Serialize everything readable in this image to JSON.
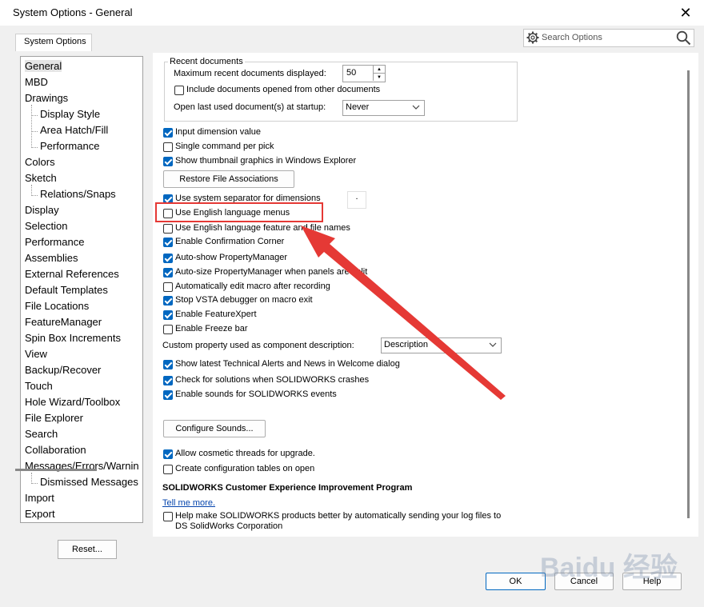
{
  "window": {
    "title": "System Options - General",
    "close_glyph": "✕"
  },
  "tab": {
    "label": "System Options"
  },
  "search": {
    "placeholder": "Search Options"
  },
  "tree": {
    "items": [
      {
        "label": "General",
        "selected": true
      },
      {
        "label": "MBD"
      },
      {
        "label": "Drawings"
      },
      {
        "label": "Display Style",
        "sub": true
      },
      {
        "label": "Area Hatch/Fill",
        "sub": true
      },
      {
        "label": "Performance",
        "sub": true
      },
      {
        "label": "Colors"
      },
      {
        "label": "Sketch"
      },
      {
        "label": "Relations/Snaps",
        "sub": true
      },
      {
        "label": "Display"
      },
      {
        "label": "Selection"
      },
      {
        "label": "Performance"
      },
      {
        "label": "Assemblies"
      },
      {
        "label": "External References"
      },
      {
        "label": "Default Templates"
      },
      {
        "label": "File Locations"
      },
      {
        "label": "FeatureManager"
      },
      {
        "label": "Spin Box Increments"
      },
      {
        "label": "View"
      },
      {
        "label": "Backup/Recover"
      },
      {
        "label": "Touch"
      },
      {
        "label": "Hole Wizard/Toolbox"
      },
      {
        "label": "File Explorer"
      },
      {
        "label": "Search"
      },
      {
        "label": "Collaboration"
      },
      {
        "label": "Messages/Errors/Warnin"
      },
      {
        "label": "Dismissed Messages",
        "sub": true
      },
      {
        "label": "Import"
      },
      {
        "label": "Export"
      }
    ]
  },
  "reset_button": "Reset...",
  "recent": {
    "legend": "Recent documents",
    "max_label": "Maximum recent documents displayed:",
    "max_value": "50",
    "include_label": "Include documents opened from other documents",
    "include_checked": false,
    "open_last_label": "Open last used document(s) at startup:",
    "open_last_value": "Never"
  },
  "options": {
    "input_dimension": {
      "label": "Input dimension value",
      "checked": true
    },
    "single_command": {
      "label": "Single command per pick",
      "checked": false
    },
    "show_thumbnail": {
      "label": "Show thumbnail graphics in Windows Explorer",
      "checked": true
    },
    "restore_assoc": "Restore File Associations",
    "system_separator": {
      "label": "Use system separator for dimensions",
      "checked": true,
      "value": "."
    },
    "english_menus": {
      "label": "Use English language menus",
      "checked": false
    },
    "english_feature": {
      "label": "Use English language feature and file names",
      "checked": false
    },
    "confirmation_corner": {
      "label": "Enable Confirmation Corner",
      "checked": true
    },
    "autoshow_pm": {
      "label": "Auto-show PropertyManager",
      "checked": true
    },
    "autosize_pm": {
      "label": "Auto-size PropertyManager when panels are split",
      "checked": true
    },
    "auto_edit_macro": {
      "label": "Automatically edit macro after recording",
      "checked": false
    },
    "stop_vsta": {
      "label": "Stop VSTA debugger on macro exit",
      "checked": true
    },
    "featurexpert": {
      "label": "Enable FeatureXpert",
      "checked": true
    },
    "freeze_bar": {
      "label": "Enable Freeze bar",
      "checked": false
    },
    "custom_prop_label": "Custom property used as component description:",
    "custom_prop_value": "Description",
    "show_alerts": {
      "label": "Show latest Technical Alerts and News in Welcome dialog",
      "checked": true
    },
    "check_solutions": {
      "label": "Check for solutions when SOLIDWORKS crashes",
      "checked": true
    },
    "enable_sounds": {
      "label": "Enable sounds for SOLIDWORKS events",
      "checked": true
    },
    "configure_sounds": "Configure Sounds...",
    "cosmetic_threads": {
      "label": "Allow cosmetic threads for upgrade.",
      "checked": true
    },
    "config_tables": {
      "label": "Create configuration tables on open",
      "checked": false
    }
  },
  "ceip": {
    "title": "SOLIDWORKS Customer Experience Improvement Program",
    "link": "Tell me more.",
    "help_line1": "Help make SOLIDWORKS products better by automatically sending your log files to",
    "help_line2": "DS SolidWorks Corporation",
    "help_checked": false
  },
  "footer": {
    "ok": "OK",
    "cancel": "Cancel",
    "help": "Help"
  },
  "annotation": {
    "color": "#e53935"
  },
  "watermark": "Baidu 经验",
  "colors": {
    "accent": "#0067c0",
    "link": "#0645ad"
  }
}
